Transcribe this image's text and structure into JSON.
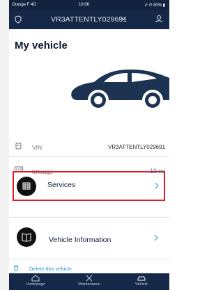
{
  "status_bar": {
    "carrier": "Orange F 4G",
    "time": "16:06",
    "right": "⇗ ⏱ 80% ▮"
  },
  "top_bar": {
    "vehicle_selector_value": "VR3ATTENTLY029691"
  },
  "page_title": "My vehicle",
  "vehicle": {
    "vin_label": "VIN",
    "vin_value": "VR3ATTENTLY029691",
    "mileage_label": "Mileage",
    "mileage_value": "19 mi"
  },
  "menu": [
    {
      "label": "Services"
    },
    {
      "label": "Vehicle Information"
    }
  ],
  "delete_label": "Delete this vehicle",
  "bottom_nav": [
    {
      "label": "Homepage",
      "icon": "home-icon"
    },
    {
      "label": "Maintenance",
      "icon": "wrench-icon"
    },
    {
      "label": "Vehicle",
      "icon": "car-icon"
    }
  ],
  "colors": {
    "header": "#152848",
    "accent": "#1c98d6",
    "highlight": "#e01b24"
  }
}
